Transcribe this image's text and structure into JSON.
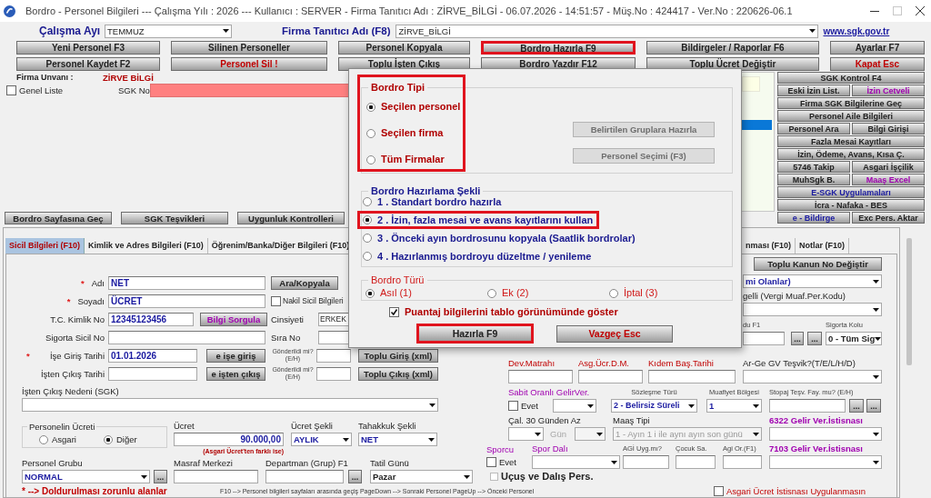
{
  "window": {
    "title": "Bordro - Personel Bilgileri --- Çalışma Yılı : 2026 --- Kullanıcı : SERVER - Firma Tanıtıcı Adı : ZİRVE_BİLGİ - 06.07.2026 - 14:51:57 - Müş.No : 424417 - Ver.No : 220626-06.1"
  },
  "header": {
    "month": {
      "label": "Çalışma Ayı",
      "value": "TEMMUZ"
    },
    "firm": {
      "label": "Firma Tanıtıcı Adı (F8)",
      "value": "ZİRVE_BİLGİ"
    },
    "link": "www.sgk.gov.tr"
  },
  "toolbar": {
    "rows": [
      {
        "buttons": [
          {
            "label": "Yeni Personel F3",
            "color": "#202020",
            "highlighted": false
          },
          {
            "label": "Silinen Personeller",
            "color": "#202020",
            "highlighted": false
          },
          {
            "label": "Personel Kopyala",
            "color": "#202020",
            "highlighted": false
          },
          {
            "label": "Bordro Hazırla F9",
            "color": "#202020",
            "highlighted": true
          },
          {
            "label": "Bildirgeler / Raporlar F6",
            "color": "#202020",
            "highlighted": false
          },
          {
            "label": "Ayarlar F7",
            "color": "#202020",
            "highlighted": false
          }
        ]
      },
      {
        "buttons": [
          {
            "label": "Personel Kaydet F2",
            "color": "#202020",
            "highlighted": false
          },
          {
            "label": "Personel Sil !",
            "color": "#c00000",
            "highlighted": false
          },
          {
            "label": "Toplu İşten Çıkış",
            "color": "#202020",
            "highlighted": false
          },
          {
            "label": "Bordro Yazdır F12",
            "color": "#202020",
            "highlighted": false
          },
          {
            "label": "Toplu Ücret Değiştir",
            "color": "#202020",
            "highlighted": false
          },
          {
            "label": "Kapat Esc",
            "color": "#c00000",
            "highlighted": false
          }
        ]
      }
    ]
  },
  "company": {
    "label": "Firma Unvanı :",
    "value": "ZİRVE BİLGİ"
  },
  "general_list": {
    "label": "Genel Liste",
    "checked": false
  },
  "sgk_no": {
    "label": "SGK No"
  },
  "side_panel": {
    "rows": [
      {
        "buttons": [
          {
            "label": "SGK Kontrol F4",
            "color": "#202020"
          }
        ]
      },
      {
        "buttons": [
          {
            "label": "Eski İzin List.",
            "color": "#202020"
          },
          {
            "label": "İzin Cetveli",
            "color": "#a000b0"
          }
        ]
      },
      {
        "buttons": [
          {
            "label": "Firma SGK Bilgilerine Geç",
            "color": "#202020"
          }
        ]
      },
      {
        "buttons": [
          {
            "label": "Personel Aile Bilgileri",
            "color": "#202020"
          }
        ]
      },
      {
        "buttons": [
          {
            "label": "Personel Ara",
            "color": "#202020"
          },
          {
            "label": "Bilgi Girişi",
            "color": "#202020"
          }
        ]
      },
      {
        "buttons": [
          {
            "label": "Fazla Mesai Kayıtları",
            "color": "#202020"
          }
        ]
      },
      {
        "buttons": [
          {
            "label": "İzin, Ödeme, Avans, Kısa Ç.",
            "color": "#202020"
          }
        ]
      },
      {
        "buttons": [
          {
            "label": "5746 Takip",
            "color": "#202020"
          },
          {
            "label": "Asgari İşçilik",
            "color": "#202020"
          }
        ]
      },
      {
        "buttons": [
          {
            "label": "MuhSgk B.",
            "color": "#202020"
          },
          {
            "label": "Maaş Excel",
            "color": "#a000b0"
          }
        ]
      },
      {
        "buttons": [
          {
            "label": "E-SGK Uygulamaları",
            "color": "#1a1aa0"
          }
        ]
      },
      {
        "buttons": [
          {
            "label": "İcra - Nafaka - BES",
            "color": "#202020"
          }
        ]
      },
      {
        "buttons": [
          {
            "label": "e - Bildirge",
            "color": "#1a1aa0"
          },
          {
            "label": "Exc Pers. Aktar",
            "color": "#202020"
          }
        ]
      }
    ]
  },
  "actions": [
    {
      "label": "Bordro Sayfasına Geç"
    },
    {
      "label": "SGK Teşvikleri"
    },
    {
      "label": "Uygunluk Kontrolleri"
    }
  ],
  "tabs": [
    {
      "label": "Sicil Bilgileri (F10)",
      "selected": true
    },
    {
      "label": "Kimlik ve Adres Bilgileri (F10)",
      "selected": false
    },
    {
      "label": "Öğrenim/Banka/Diğer Bilgileri (F10)",
      "selected": false
    },
    {
      "label": "nması (F10)",
      "selected": false
    },
    {
      "label": "Notlar (F10)",
      "selected": false
    }
  ],
  "sicil": {
    "name": {
      "marker": "*",
      "label": "Adı",
      "value": "NET"
    },
    "search_button": "Ara/Kopyala",
    "surname": {
      "marker": "*",
      "label": "Soyadı",
      "value": "ÜCRET"
    },
    "transfer": {
      "label": "Nakil Sicil Bilgileri",
      "checked": false
    },
    "tc_no": {
      "label": "T.C. Kimlik No",
      "value": "12345123456"
    },
    "query_button": "Bilgi Sorgula",
    "gender": {
      "label": "Cinsiyeti",
      "value": "ERKEK"
    },
    "insurance_no": {
      "label": "Sigorta Sicil No"
    },
    "order_no": {
      "label": "Sıra No"
    },
    "start_date": {
      "marker": "*",
      "label": "İşe Giriş Tarihi",
      "value": "01.01.2026",
      "button": "e işe giriş",
      "sent": "Gönderildi mi? (E/H)",
      "bulk": "Toplu Giriş (xml)"
    },
    "end_date": {
      "label": "İşten Çıkış Tarihi",
      "button": "e işten çıkış",
      "sent": "Gönderildi mi? (E/H)",
      "bulk": "Toplu Çıkış (xml)"
    },
    "exit_reason": {
      "label": "İşten Çıkış Nedeni (SGK)"
    },
    "wage_type": {
      "label": "Personelin Ücreti",
      "options": [
        {
          "label": "Asgari",
          "selected": false
        },
        {
          "label": "Diğer",
          "selected": true
        }
      ]
    },
    "wage": {
      "label": "Ücret",
      "value": "90.000,00",
      "note": "(Asgari Ücret'ten farklı ise)"
    },
    "wage_mode": {
      "label": "Ücret Şekli",
      "value": "AYLIK"
    },
    "accrual": {
      "label": "Tahakkuk Şekli",
      "value": "NET"
    },
    "group": {
      "label": "Personel Grubu",
      "value": "NORMAL",
      "more": "..."
    },
    "cost_center": {
      "label": "Masraf Merkezi"
    },
    "department": {
      "label": "Departman (Grup) F1",
      "more": "..."
    },
    "holiday": {
      "label": "Tatil Günü",
      "value": "Pazar"
    }
  },
  "sicil_right": {
    "law_button": "Toplu Kanun No Değiştir",
    "combo_1": {
      "value": "mi Olanlar)"
    },
    "field_2": {
      "label": "gelli (Vergi Muaf.Per.Kodu)"
    },
    "field_3": {
      "label": "du F1",
      "more": [
        "...",
        "..."
      ]
    },
    "insurance_branch": {
      "label": "Sigorta Kolu",
      "value": "0 - Tüm Sig"
    },
    "dev_base": {
      "label": "Dev.Matrahı"
    },
    "min_wage_dm": {
      "label": "Asg.Ücr.D.M."
    },
    "seniority": {
      "label": "Kıdem Baş.Tarihi"
    },
    "rnd": {
      "label": "Ar-Ge GV Teşvik?(T/E/L/H/D)"
    },
    "fixed_rate": {
      "label": "Sabit Oranlı GelirVer.",
      "check_label": "Evet",
      "checked": false
    },
    "contract": {
      "label": "Sözleşme Türü",
      "value": "2 - Belirsiz Süreli"
    },
    "exempt_region": {
      "label": "Muafiyet Bölgesi",
      "value": "1"
    },
    "stopaj": {
      "label": "Stopaj Teşv. Fay. mu? (E/H)",
      "more": [
        "...",
        "..."
      ]
    },
    "under30": {
      "label": "Çal. 30 Günden Az"
    },
    "day": {
      "label": "Gün",
      "disabled": true
    },
    "pay_type": {
      "label": "Maaş Tipi",
      "value": "1 - Ayın 1 i ile aynı ayın son günü",
      "disabled": true
    },
    "exempt_6322": {
      "label": "6322 Gelir Ver.İstisnası"
    },
    "athlete": {
      "label": "Sporcu",
      "check_label": "Evet",
      "checked": false
    },
    "sport": {
      "label": "Spor Dalı"
    },
    "agi": {
      "label": "AGİ Uyg.mı?"
    },
    "children": {
      "label": "Çocuk Sa."
    },
    "agi_ratio": {
      "label": "Agi Or.(F1)"
    },
    "exempt_7103": {
      "label": "7103 Gelir Ver.İstisnası"
    },
    "flight": {
      "label": "Uçuş ve Dalış Pers.",
      "checked": false
    }
  },
  "footer": {
    "required_note": "* --> Doldurulması zorunlu alanlar",
    "keys_hint": "F10 --> Personel bilgileri sayfaları arasında geçiş  PageDown --> Sonraki Personel  PageUp --> Önceki Personel",
    "min_wage_exempt": {
      "label": "Asgari Ücret İstisnası Uygulanmasın",
      "checked": false
    }
  },
  "dialog": {
    "type_group": {
      "title": "Bordro Tipi",
      "highlighted": true,
      "options": [
        {
          "label": "Seçilen personel",
          "selected": true
        },
        {
          "label": "Seçilen firma",
          "selected": false
        },
        {
          "label": "Tüm Firmalar",
          "selected": false
        }
      ],
      "buttons": [
        {
          "label": "Belirtilen Gruplara Hazırla",
          "disabled": true
        },
        {
          "label": "Personel Seçimi (F3)",
          "disabled": true
        }
      ]
    },
    "method_group": {
      "title": "Bordro Hazırlama Şekli",
      "options": [
        {
          "label": "1 . Standart bordro hazırla",
          "selected": false,
          "highlighted": false
        },
        {
          "label": "2 . İzin, fazla mesai ve avans kayıtlarını kullan",
          "selected": true,
          "highlighted": true
        },
        {
          "label": "3 . Önceki ayın bordrosunu kopyala (Saatlik bordrolar)",
          "selected": false,
          "highlighted": false
        },
        {
          "label": "4 . Hazırlanmış bordroyu düzeltme / yenileme",
          "selected": false,
          "highlighted": false
        }
      ]
    },
    "kind_group": {
      "title": "Bordro Türü",
      "options": [
        {
          "label": "Asıl (1)",
          "selected": true
        },
        {
          "label": "Ek (2)",
          "selected": false
        },
        {
          "label": "İptal (3)",
          "selected": false
        }
      ]
    },
    "show_table": {
      "label": "Puantaj bilgilerini tablo görünümünde göster",
      "checked": true
    },
    "buttons": [
      {
        "label": "Hazırla F9",
        "color": "#202020",
        "highlighted": true
      },
      {
        "label": "Vazgeç Esc",
        "color": "#c00000",
        "highlighted": false
      }
    ]
  }
}
